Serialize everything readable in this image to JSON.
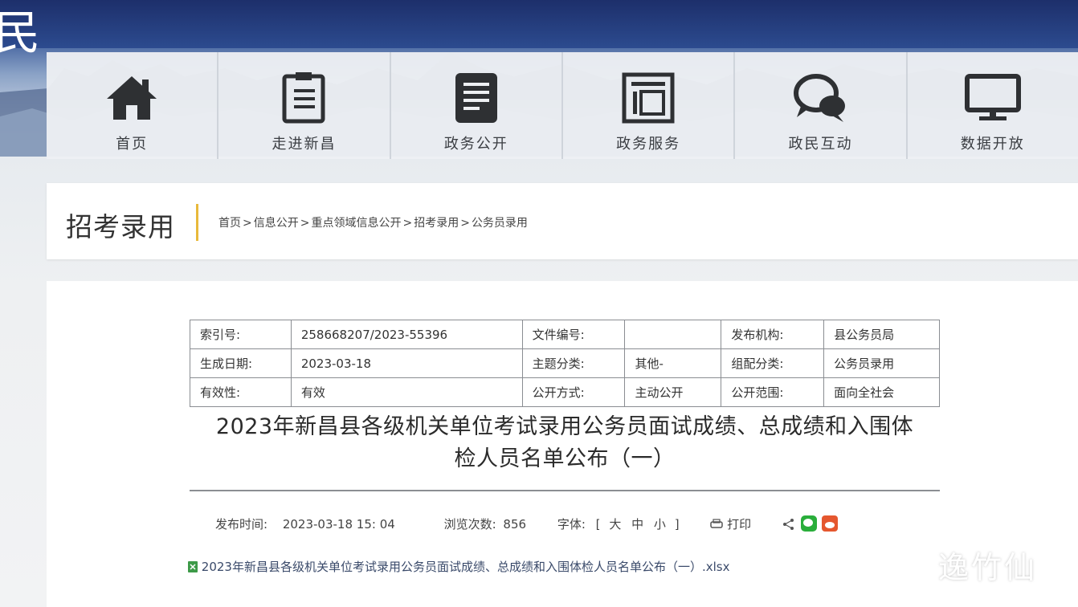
{
  "hero": {
    "corner_glyph": "民"
  },
  "nav": {
    "items": [
      {
        "label": "首页",
        "icon": "home-icon"
      },
      {
        "label": "走进新昌",
        "icon": "document-list-icon"
      },
      {
        "label": "政务公开",
        "icon": "document-lines-icon"
      },
      {
        "label": "政务服务",
        "icon": "building-frame-icon"
      },
      {
        "label": "政民互动",
        "icon": "chat-bubbles-icon"
      },
      {
        "label": "数据开放",
        "icon": "monitor-icon"
      }
    ]
  },
  "section": {
    "title": "招考录用",
    "breadcrumb": [
      "首页",
      "信息公开",
      "重点领域信息公开",
      "招考录用",
      "公务员录用"
    ],
    "separator": ">"
  },
  "meta_table": {
    "rows": [
      [
        "索引号:",
        "258668207/2023-55396",
        "文件编号:",
        "",
        "发布机构:",
        "县公务员局"
      ],
      [
        "生成日期:",
        "2023-03-18",
        "主题分类:",
        "其他-",
        "组配分类:",
        "公务员录用"
      ],
      [
        "有效性:",
        "有效",
        "公开方式:",
        "主动公开",
        "公开范围:",
        "面向全社会"
      ]
    ]
  },
  "document": {
    "title_line1": "2023年新昌县各级机关单位考试录用公务员面试成绩、总成绩和入围体",
    "title_line2": "检人员名单公布（一）"
  },
  "info": {
    "publish_label": "发布时间:",
    "publish_time": "2023-03-18 15: 04",
    "views_label": "浏览次数:",
    "views": "856",
    "font_label": "字体:",
    "font_open": "[",
    "font_large": "大",
    "font_medium": "中",
    "font_small": "小",
    "font_close": "]",
    "print_label": "打印"
  },
  "attachment": {
    "text": "2023年新昌县各级机关单位考试录用公务员面试成绩、总成绩和入围体检人员名单公布（一）.xlsx"
  },
  "watermark": "逸竹仙",
  "colors": {
    "accent_divider": "#e8b93b",
    "wechat_green": "#2aae3b",
    "weibo_orange": "#e5572f"
  }
}
